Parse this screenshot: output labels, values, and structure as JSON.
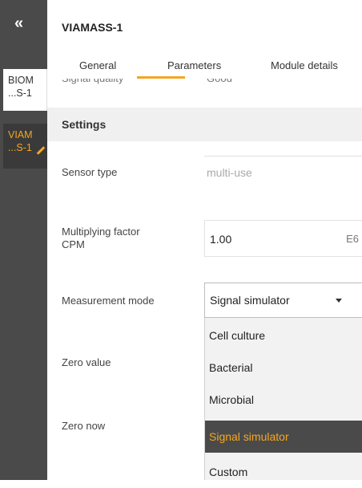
{
  "sidebar": {
    "collapse_glyph": "«",
    "items": [
      {
        "line1": "BIOM",
        "line2": "...S-1"
      },
      {
        "line1": "VIAM",
        "line2": "...S-1"
      }
    ]
  },
  "header": {
    "title": "VIAMASS-1"
  },
  "tabs": [
    {
      "label": "General"
    },
    {
      "label": "Parameters"
    },
    {
      "label": "Module details"
    }
  ],
  "peek": {
    "label": "Signal quality",
    "value": "Good"
  },
  "settings": {
    "heading": "Settings",
    "sensor_type": {
      "label": "Sensor type",
      "value": "multi-use"
    },
    "multiplying_factor": {
      "label_line1": "Multiplying factor",
      "label_line2": "CPM",
      "value": "1.00",
      "unit": "E6"
    },
    "measurement_mode": {
      "label": "Measurement mode",
      "selected": "Signal simulator",
      "options": [
        "Cell culture",
        "Bacterial",
        "Microbial",
        "Signal simulator",
        "Custom"
      ]
    },
    "zero_value": {
      "label": "Zero value"
    },
    "zero_now": {
      "label": "Zero now"
    }
  },
  "colors": {
    "accent": "#f5a623",
    "sidebar_bg": "#4a4a4a",
    "selected_option_bg": "#4a4a4a"
  },
  "icons": {
    "collapse": "double-chevron-left-icon",
    "edit": "pencil-icon",
    "dropdown": "caret-down-icon"
  }
}
